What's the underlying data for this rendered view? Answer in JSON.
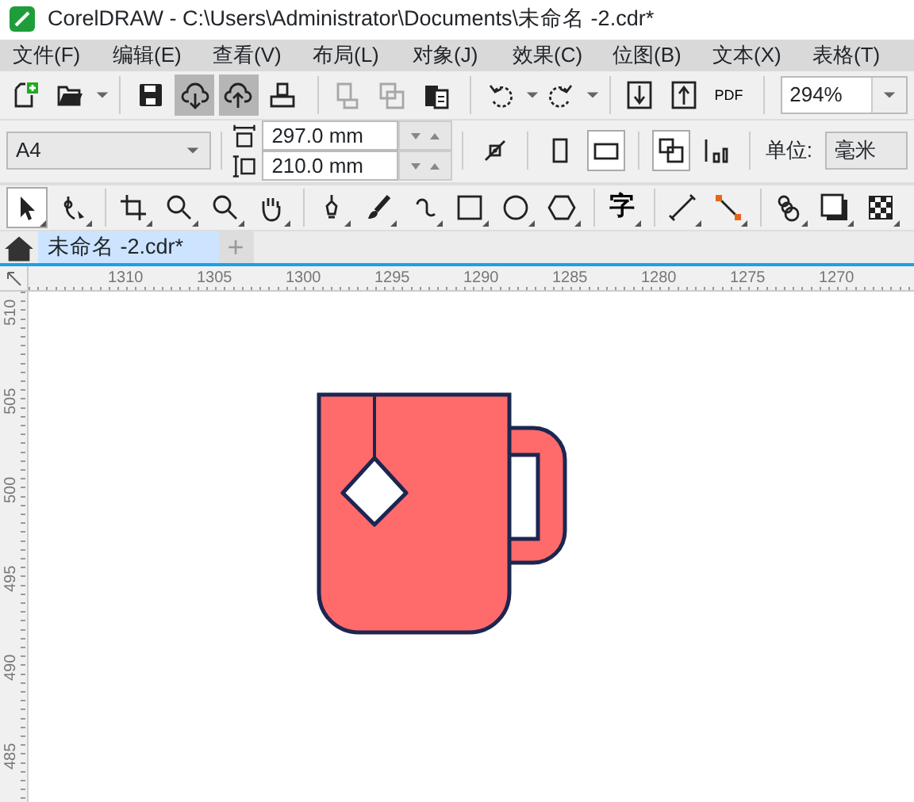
{
  "window": {
    "title": "CorelDRAW - C:\\Users\\Administrator\\Documents\\未命名 -2.cdr*"
  },
  "menu": [
    "文件(F)",
    "编辑(E)",
    "查看(V)",
    "布局(L)",
    "对象(J)",
    "效果(C)",
    "位图(B)",
    "文本(X)",
    "表格(T)"
  ],
  "standard_toolbar": [
    {
      "kind": "new",
      "pressed": false,
      "disabled": false
    },
    {
      "kind": "open",
      "pressed": false,
      "disabled": false,
      "dropdown": true
    },
    {
      "kind": "sep"
    },
    {
      "kind": "save",
      "pressed": false,
      "disabled": false
    },
    {
      "kind": "cloud-down",
      "pressed": true,
      "disabled": false
    },
    {
      "kind": "cloud-up",
      "pressed": true,
      "disabled": false
    },
    {
      "kind": "print",
      "pressed": false,
      "disabled": false
    },
    {
      "kind": "sep"
    },
    {
      "kind": "cut",
      "pressed": false,
      "disabled": true
    },
    {
      "kind": "copy",
      "pressed": false,
      "disabled": true
    },
    {
      "kind": "paste",
      "pressed": false,
      "disabled": false
    },
    {
      "kind": "sep"
    },
    {
      "kind": "undo",
      "pressed": false,
      "disabled": false,
      "dropdown": true
    },
    {
      "kind": "redo",
      "pressed": false,
      "disabled": false,
      "dropdown": true
    },
    {
      "kind": "sep"
    },
    {
      "kind": "import",
      "pressed": false,
      "disabled": false
    },
    {
      "kind": "export",
      "pressed": false,
      "disabled": false
    },
    {
      "kind": "pdf",
      "label": "PDF",
      "pressed": false,
      "disabled": false
    },
    {
      "kind": "sep"
    }
  ],
  "zoom_level": "294%",
  "property_bar": {
    "page_size": "A4",
    "width": "297.0 mm",
    "height": "210.0 mm",
    "orientation": [
      {
        "kind": "portrait",
        "selected": false
      },
      {
        "kind": "landscape",
        "selected": true
      }
    ],
    "all_pages": true,
    "units_label": "单位:",
    "units": "毫米"
  },
  "toolbox": [
    {
      "kind": "pick",
      "selected": true
    },
    {
      "kind": "shape",
      "selected": false
    },
    {
      "kind": "sep"
    },
    {
      "kind": "crop",
      "selected": false
    },
    {
      "kind": "zoom",
      "selected": false
    },
    {
      "kind": "zoom2",
      "selected": false
    },
    {
      "kind": "pan",
      "selected": false
    },
    {
      "kind": "sep"
    },
    {
      "kind": "pen",
      "selected": false
    },
    {
      "kind": "brush",
      "selected": false
    },
    {
      "kind": "curve",
      "selected": false
    },
    {
      "kind": "rect",
      "selected": false
    },
    {
      "kind": "ellipse",
      "selected": false
    },
    {
      "kind": "polygon",
      "selected": false
    },
    {
      "kind": "sep"
    },
    {
      "kind": "text",
      "label": "字",
      "selected": false
    },
    {
      "kind": "sep"
    },
    {
      "kind": "dimension",
      "selected": false
    },
    {
      "kind": "connector",
      "selected": false
    },
    {
      "kind": "sep"
    },
    {
      "kind": "blend",
      "selected": false
    },
    {
      "kind": "shadow",
      "selected": false
    },
    {
      "kind": "transparency",
      "selected": false
    }
  ],
  "tabs": [
    {
      "label": "未命名 -2.cdr*",
      "selected": true
    }
  ],
  "new_tab": "+",
  "ruler_h": [
    "1310",
    "1305",
    "1300",
    "1295",
    "1290",
    "1285",
    "1280",
    "1275",
    "1270"
  ],
  "ruler_v": [
    "510",
    "505",
    "500",
    "495",
    "490",
    "485"
  ]
}
